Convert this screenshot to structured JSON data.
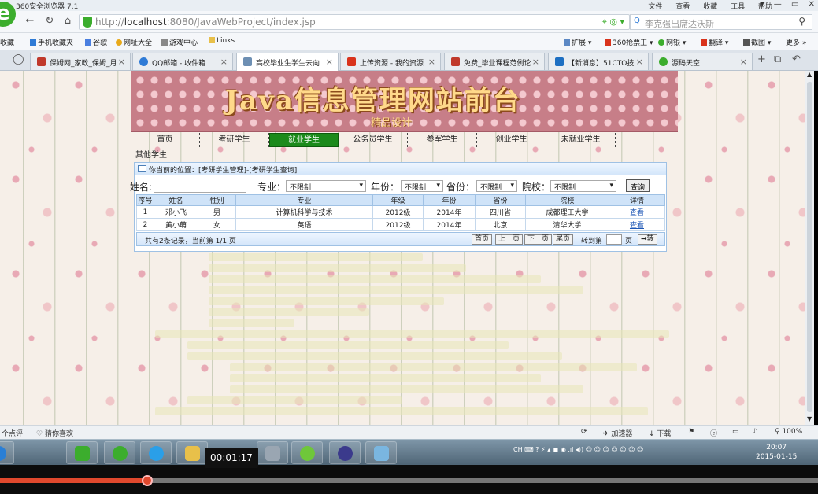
{
  "browser": {
    "window_title": "360安全浏览器 7.1",
    "menu": [
      "文件",
      "查看",
      "收藏",
      "工具",
      "帮助"
    ],
    "url_host": "http://",
    "url_main": "localhost",
    "url_rest": ":8080/JavaWebProject/index.jsp",
    "search_placeholder": "李克强出席达沃斯",
    "bookmarks_left": [
      "收藏",
      "手机收藏夹",
      "谷歌",
      "网址大全",
      "游戏中心",
      "Links"
    ],
    "bookmarks_right": [
      "扩展",
      "360抢票王",
      "网银",
      "翻译",
      "截图",
      "更多"
    ],
    "tabs": [
      {
        "label": "保姆网_家政_保姆_月",
        "color": "#c0392b"
      },
      {
        "label": "QQ邮箱 - 收件箱",
        "color": "#2f7bd6"
      },
      {
        "label": "高校毕业生学生去向",
        "color": "#6d8fb3",
        "active": true
      },
      {
        "label": "上传资源 - 我的资源",
        "color": "#d9331c"
      },
      {
        "label": "免费_毕业课程范例论",
        "color": "#c0392b"
      },
      {
        "label": "【新消息】51CTO技",
        "color": "#1d6fc2"
      },
      {
        "label": "源码天空",
        "color": "#3cad2d"
      }
    ]
  },
  "site": {
    "title": "Java信息管理网站前台",
    "subtitle": "精品设计",
    "nav": [
      "首页",
      "考研学生",
      "就业学生",
      "公务员学生",
      "参军学生",
      "创业学生",
      "未就业学生"
    ],
    "nav_active": "就业学生",
    "nav_extra": "其他学生",
    "location_label": "你当前的位置：[考研学生管理]-[考研学生查询]",
    "filters": {
      "name_label": "姓名:",
      "major_label": "专业：",
      "major_value": "不限制",
      "year_label": "年份：",
      "year_value": "不限制",
      "province_label": "省份：",
      "province_value": "不限制",
      "school_label": "院校：",
      "school_value": "不限制",
      "query_button": "查询"
    },
    "table": {
      "headers": [
        "序号",
        "姓名",
        "性别",
        "专业",
        "年级",
        "年份",
        "省份",
        "院校",
        "详情"
      ],
      "rows": [
        [
          "1",
          "邓小飞",
          "男",
          "计算机科学与技术",
          "2012级",
          "2014年",
          "四川省",
          "成都理工大学",
          "查看"
        ],
        [
          "2",
          "黄小萌",
          "女",
          "英语",
          "2012级",
          "2014年",
          "北京",
          "清华大学",
          "查看"
        ]
      ]
    },
    "pager": {
      "info": "共有2条记录，当前第 1/1 页",
      "first": "首页",
      "prev": "上一页",
      "next": "下一页",
      "last": "尾页",
      "goto_label": "转到第",
      "page_unit": "页",
      "go": "➡转"
    }
  },
  "statusbar": {
    "left1": "个点评",
    "left2": "猜你喜欢",
    "accel": "加速器",
    "download": "下载",
    "zoom": "100%"
  },
  "taskbar": {
    "tray_lang": "CH",
    "time": "20:07",
    "date": "2015-01-15"
  },
  "video": {
    "timecode": "00:01:17",
    "progress": 0.18
  }
}
